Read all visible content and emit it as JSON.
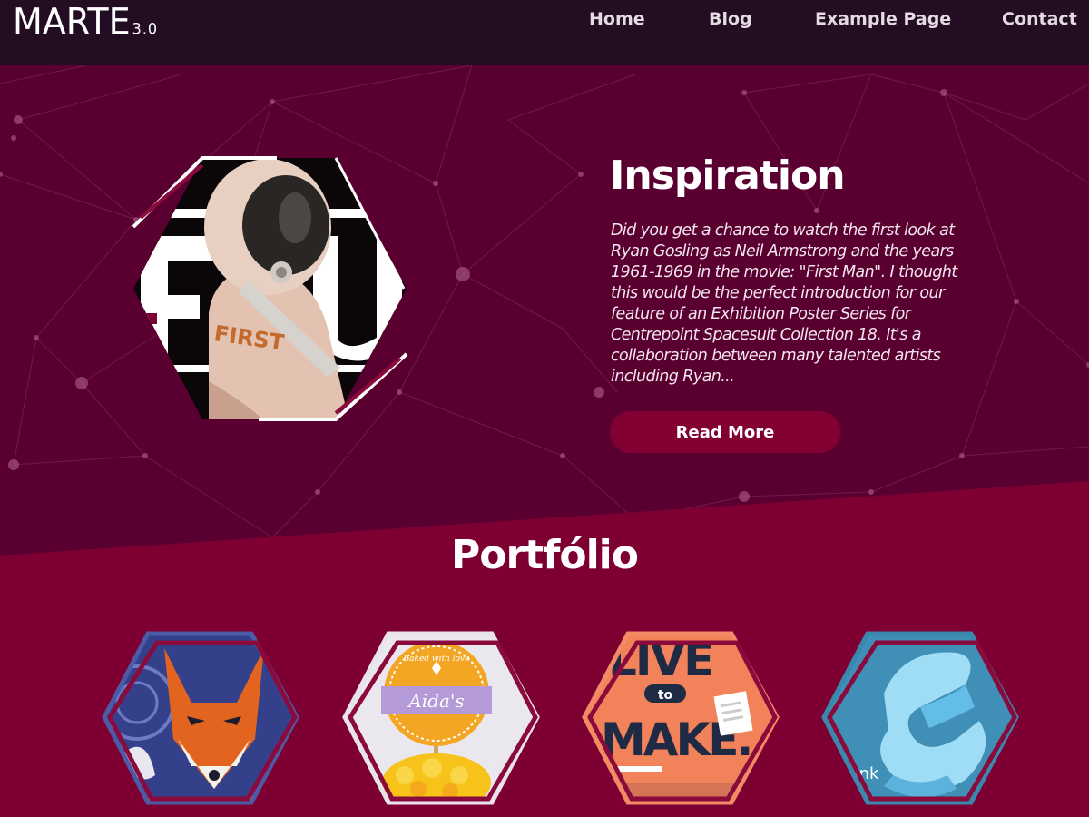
{
  "brand": {
    "name": "MARTE",
    "version": "3.0"
  },
  "nav": {
    "items": [
      {
        "label": "Home"
      },
      {
        "label": "Blog"
      },
      {
        "label": "Example Page"
      },
      {
        "label": "Contact"
      }
    ]
  },
  "hero": {
    "title": "Inspiration",
    "excerpt": "Did you get a chance to watch the first look at Ryan Gosling as Neil Armstrong and the years 1961-1969 in the movie: \"First Man\". I thought this would be the perfect introduction for our feature of an Exhibition Poster Series for Centrepoint Spacesuit Collection 18. It's a collaboration between many talented artists including Ryan...",
    "button_label": "Read More",
    "image_icon": "astronaut-poster-image",
    "image_texts": [
      "F",
      "U",
      "FIRST"
    ]
  },
  "portfolio": {
    "title": "Portfólio",
    "items": [
      {
        "icon": "fox-illustration-image"
      },
      {
        "icon": "aidas-cupcake-image",
        "text": "Aida's",
        "subtext": "Baked with love"
      },
      {
        "icon": "live-to-make-poster-image",
        "lines": [
          "LIVE",
          "to",
          "MAKE."
        ]
      },
      {
        "icon": "blue-ribbon-logo-image",
        "text": "ynk"
      }
    ]
  },
  "colors": {
    "header_bg": "#220d22",
    "hero_bg": "#5a0030",
    "portfolio_bg": "#7e0033",
    "button_bg": "#830033",
    "accent": "#8a0a3c"
  }
}
